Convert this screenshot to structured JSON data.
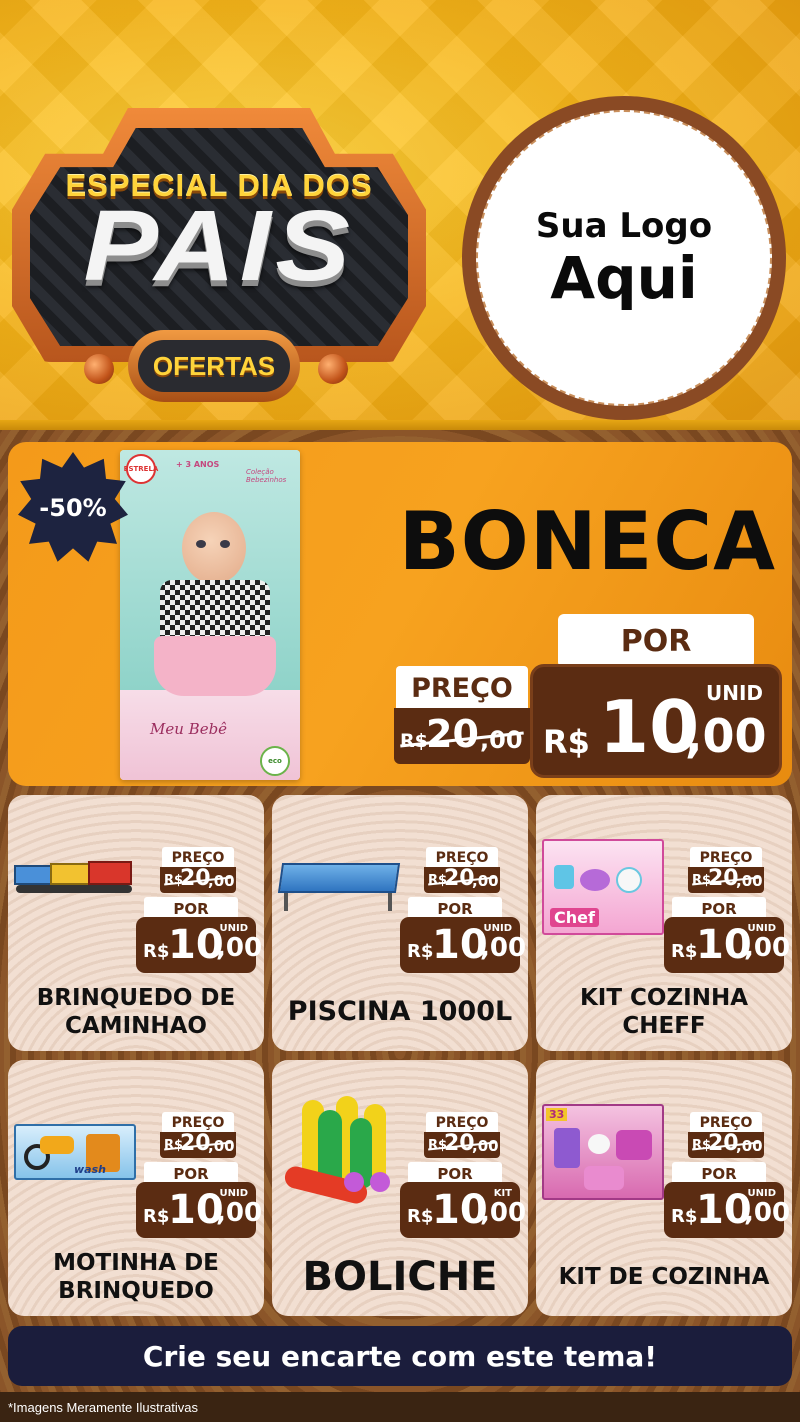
{
  "header": {
    "badge_top": "ESPECIAL DIA DOS",
    "badge_main": "PAIS",
    "badge_sub": "OFERTAS",
    "logo_line1": "Sua Logo",
    "logo_line2": "Aqui"
  },
  "hero": {
    "discount": "-50%",
    "title": "BONECA",
    "por_label": "POR",
    "preco_label": "PREÇO",
    "old_currency": "R$",
    "old_int": "20",
    "old_cents": ",00",
    "unit": "UNID",
    "currency": "R$",
    "price_int": "10",
    "price_cents": ",00",
    "box": {
      "brand": "ESTRELA",
      "age": "+ 3 ANOS",
      "tag": "Coleção Bebezinhos",
      "name": "Meu Bebê",
      "eco": "eco"
    }
  },
  "products": [
    {
      "name": "BRINQUEDO DE CAMINHAO",
      "preco_label": "PREÇO",
      "old_currency": "R$",
      "old_int": "20",
      "old_cents": ",00",
      "por_label": "POR",
      "unit": "UNID",
      "currency": "R$",
      "price_int": "10",
      "price_cents": ",00"
    },
    {
      "name": "PISCINA 1000L",
      "preco_label": "PREÇO",
      "old_currency": "R$",
      "old_int": "20",
      "old_cents": ",00",
      "por_label": "POR",
      "unit": "UNID",
      "currency": "R$",
      "price_int": "10",
      "price_cents": ",00"
    },
    {
      "name": "KIT COZINHA CHEFF",
      "preco_label": "PREÇO",
      "old_currency": "R$",
      "old_int": "20",
      "old_cents": ",00",
      "por_label": "POR",
      "unit": "UNID",
      "currency": "R$",
      "price_int": "10",
      "price_cents": ",00",
      "box_text": "Chef"
    },
    {
      "name": "MOTINHA DE BRINQUEDO",
      "preco_label": "PREÇO",
      "old_currency": "R$",
      "old_int": "20",
      "old_cents": ",00",
      "por_label": "POR",
      "unit": "UNID",
      "currency": "R$",
      "price_int": "10",
      "price_cents": ",00",
      "box_text": "wash"
    },
    {
      "name": "BOLICHE",
      "preco_label": "PREÇO",
      "old_currency": "R$",
      "old_int": "20",
      "old_cents": ",00",
      "por_label": "POR",
      "unit": "KIT",
      "currency": "R$",
      "price_int": "10",
      "price_cents": ",00"
    },
    {
      "name": "KIT DE COZINHA",
      "preco_label": "PREÇO",
      "old_currency": "R$",
      "old_int": "20",
      "old_cents": ",00",
      "por_label": "POR",
      "unit": "UNID",
      "currency": "R$",
      "price_int": "10",
      "price_cents": ",00",
      "box_text": "33"
    }
  ],
  "cta": {
    "label": "Crie seu encarte com este tema!"
  },
  "footer": {
    "disclaimer": "*Imagens Meramente Ilustrativas"
  }
}
